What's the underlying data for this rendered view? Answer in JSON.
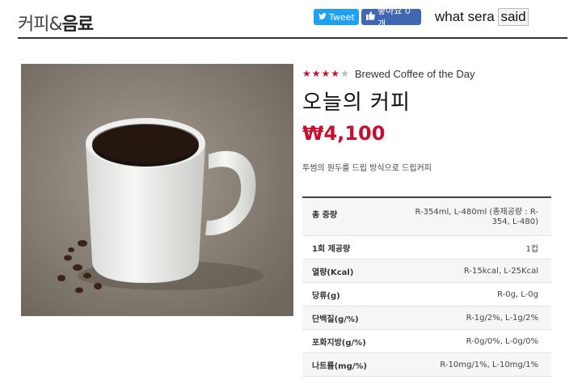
{
  "header": {
    "title_thin": "커피&",
    "title_bold": "음료",
    "tweet_label": "Tweet",
    "like_label": "좋아요 0개",
    "caption_prefix": "what sera",
    "caption_boxed": "said"
  },
  "product": {
    "rating_stars": 4,
    "rating_max": 5,
    "eng_name": "Brewed Coffee of the Day",
    "kor_name": "오늘의 커피",
    "price": "₩4,100",
    "description": "투썸의 원두를 드립 방식으로 드립커피"
  },
  "nutrition": [
    {
      "label": "총 중량",
      "value": "R-354ml, L-480ml (총제공량 : R-354, L-480)"
    },
    {
      "label": "1회 제공량",
      "value": "1컵"
    },
    {
      "label": "열량(Kcal)",
      "value": "R-15kcal, L-25Kcal"
    },
    {
      "label": "당류(g)",
      "value": "R-0g, L-0g"
    },
    {
      "label": "단백질(g/%)",
      "value": "R-1g/2%, L-1g/2%"
    },
    {
      "label": "포화지방(g/%)",
      "value": "R-0g/0%, L-0g/0%"
    },
    {
      "label": "나트륨(mg/%)",
      "value": "R-10mg/1%, L-10mg/1%"
    }
  ],
  "colors": {
    "accent": "#c8102e",
    "twitter": "#1da1f2",
    "facebook": "#4267b2"
  },
  "icons": {
    "tweet": "twitter-bird-icon",
    "like": "thumbs-up-icon",
    "star": "star-icon"
  }
}
